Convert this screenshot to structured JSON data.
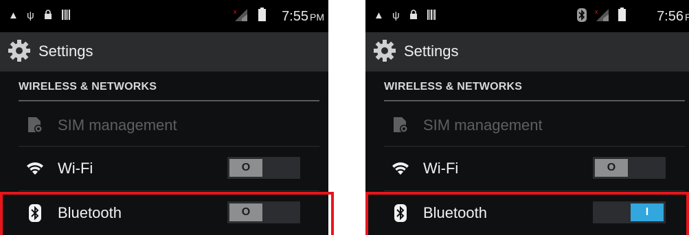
{
  "panels": [
    {
      "status": {
        "time": "7:55",
        "ampm": "PM"
      },
      "title": "Settings",
      "section": "WIRELESS & NETWORKS",
      "items": [
        {
          "label": "SIM management",
          "enabled": false
        },
        {
          "label": "Wi-Fi",
          "toggle": "O"
        },
        {
          "label": "Bluetooth",
          "toggle": "O"
        }
      ]
    },
    {
      "status": {
        "time": "7:56",
        "ampm": "PM"
      },
      "title": "Settings",
      "section": "WIRELESS & NETWORKS",
      "items": [
        {
          "label": "SIM management",
          "enabled": false
        },
        {
          "label": "Wi-Fi",
          "toggle": "O"
        },
        {
          "label": "Bluetooth",
          "toggle": "I"
        }
      ]
    }
  ],
  "colors": {
    "accent": "#31a7dd",
    "highlight": "#e8151a",
    "background": "#0f1011"
  }
}
